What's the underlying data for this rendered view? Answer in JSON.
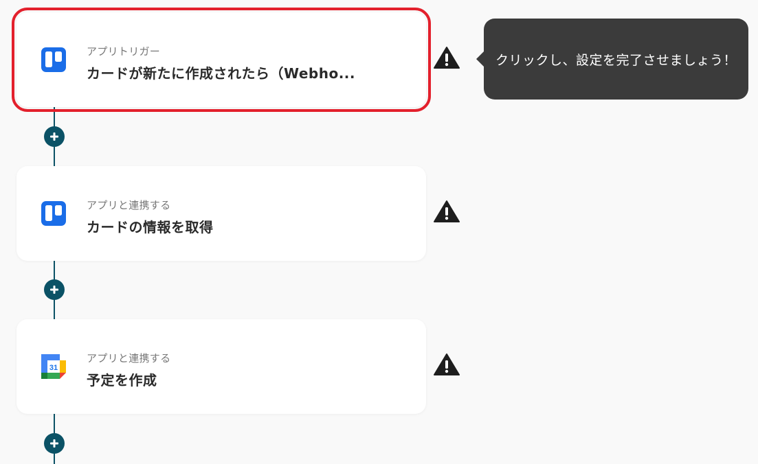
{
  "colors": {
    "accent": "#0b5266",
    "selected_outline": "#e3202c",
    "tooltip_bg": "#3b3b3b",
    "trello_blue": "#1a6de8"
  },
  "steps": [
    {
      "subtitle": "アプリトリガー",
      "title": "カードが新たに作成されたら（Webho...",
      "app_icon": "trello-icon",
      "status_icon": "warning-icon"
    },
    {
      "subtitle": "アプリと連携する",
      "title": "カードの情報を取得",
      "app_icon": "trello-icon",
      "status_icon": "warning-icon"
    },
    {
      "subtitle": "アプリと連携する",
      "title": "予定を作成",
      "app_icon": "google-calendar-icon",
      "status_icon": "warning-icon"
    }
  ],
  "tooltip": {
    "text": "クリックし、設定を完了させましょう！"
  },
  "add_step_icon": "plus-icon",
  "calendar_day": "31"
}
